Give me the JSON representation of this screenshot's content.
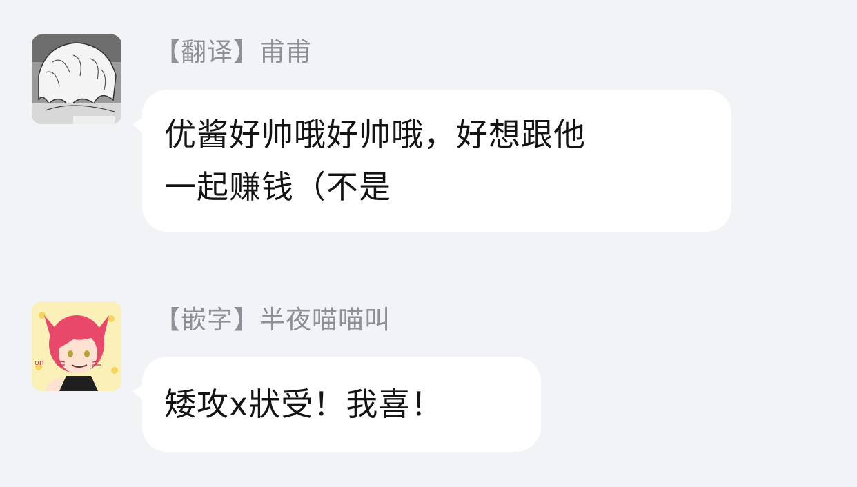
{
  "messages": [
    {
      "sender": "【翻译】甫甫",
      "avatar": "manga-white-hair-avatar",
      "lines": [
        "优酱好帅哦好帅哦，好想跟他",
        "一起赚钱（不是"
      ]
    },
    {
      "sender": "【嵌字】半夜喵喵叫",
      "avatar": "red-hair-cat-ear-avatar",
      "lines": [
        "矮攻x狀受！我喜！"
      ]
    }
  ],
  "colors": {
    "background": "#f2f3f7",
    "bubble": "#ffffff",
    "sender_text": "#8e9097",
    "message_text": "#141414"
  }
}
